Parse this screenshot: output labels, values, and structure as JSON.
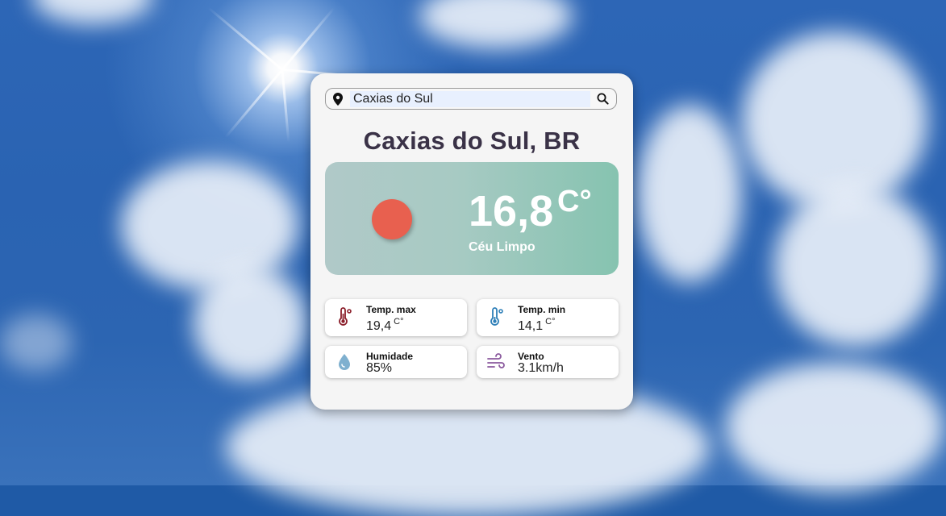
{
  "search": {
    "value": "Caxias do Sul",
    "placeholder": ""
  },
  "weather": {
    "city": "Caxias do Sul, BR",
    "temperature": "16,8",
    "unit": "C°",
    "description": "Céu Limpo",
    "icon_color": "#e8604f"
  },
  "details": {
    "temp_max": {
      "label": "Temp. max",
      "value": "19,4",
      "unit": "C°",
      "icon": "thermometer-hot-icon"
    },
    "temp_min": {
      "label": "Temp. min",
      "value": "14,1",
      "unit": "C°",
      "icon": "thermometer-cold-icon"
    },
    "humidity": {
      "label": "Humidade",
      "value": "85%",
      "icon": "water-drop-icon"
    },
    "wind": {
      "label": "Vento",
      "value": "3.1km/h",
      "icon": "wind-icon"
    }
  },
  "colors": {
    "card_bg": "#f5f5f5",
    "title": "#3a3247",
    "panel_gradient_start": "#b0c9c8",
    "panel_gradient_end": "#86c3b0"
  }
}
